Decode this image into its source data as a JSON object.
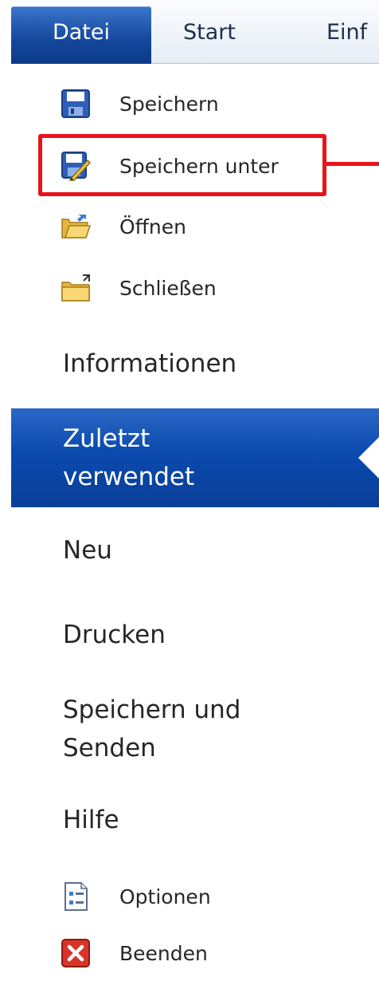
{
  "ribbon": {
    "tabs": [
      {
        "label": "Datei"
      },
      {
        "label": "Start"
      },
      {
        "label": "Einf"
      }
    ]
  },
  "backstage": {
    "commands_top": [
      {
        "label": "Speichern",
        "icon": "save-icon"
      },
      {
        "label": "Speichern unter",
        "icon": "save-as-icon"
      },
      {
        "label": "Öffnen",
        "icon": "open-folder-icon"
      },
      {
        "label": "Schließen",
        "icon": "close-folder-icon"
      }
    ],
    "nav": [
      {
        "label": "Informationen"
      },
      {
        "label": "Zuletzt verwendet",
        "line1": "Zuletzt",
        "line2": "verwendet",
        "active": true
      },
      {
        "label": "Neu"
      },
      {
        "label": "Drucken"
      },
      {
        "label": "Speichern und Senden",
        "line1": "Speichern und",
        "line2": "Senden"
      },
      {
        "label": "Hilfe"
      }
    ],
    "commands_bottom": [
      {
        "label": "Optionen",
        "icon": "options-icon"
      },
      {
        "label": "Beenden",
        "icon": "exit-icon"
      }
    ]
  },
  "colors": {
    "active_tab": "#14479c",
    "active_nav": "#0b4aae",
    "highlight": "#e8141c"
  }
}
